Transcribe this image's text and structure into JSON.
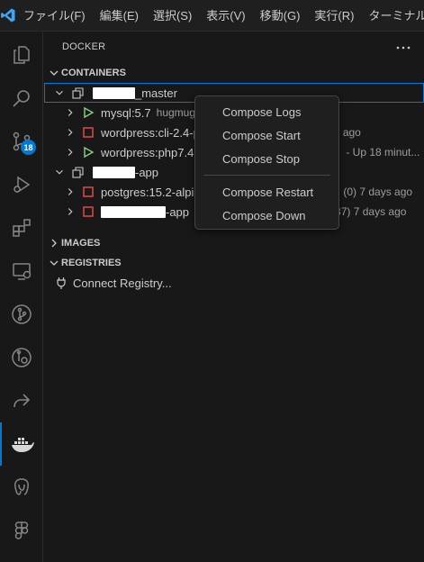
{
  "menubar": {
    "items": [
      "ファイル(F)",
      "編集(E)",
      "選択(S)",
      "表示(V)",
      "移動(G)",
      "実行(R)",
      "ターミナル(T)"
    ]
  },
  "activity": {
    "scm_badge": "18",
    "icons": [
      "explorer-icon",
      "search-icon",
      "source-control-icon",
      "run-debug-icon",
      "extensions-icon",
      "remote-explorer-icon",
      "git-graph-icon",
      "gitlens-icon",
      "share-icon",
      "docker-icon",
      "postgres-icon",
      "figma-icon"
    ]
  },
  "docker": {
    "title": "DOCKER",
    "sections": {
      "containers": "CONTAINERS",
      "images": "IMAGES",
      "registries": "REGISTRIES"
    },
    "groups": [
      {
        "name_suffix": "_master",
        "containers": [
          {
            "label": "mysql:5.7",
            "desc": "hugmug",
            "status": "running"
          },
          {
            "label": "wordpress:cli-2.4-p",
            "desc": "ago",
            "status": "stopped"
          },
          {
            "label": "wordpress:php7.4",
            "desc": "- Up 18 minut...",
            "status": "running"
          }
        ]
      },
      {
        "name_suffix": "-app",
        "containers": [
          {
            "label": "postgres:15.2-alpi",
            "desc": "(0) 7 days ago",
            "status": "stopped"
          },
          {
            "label": "-app",
            "desc": "37) 7 days ago",
            "status": "stopped"
          }
        ]
      }
    ],
    "registry_action": "Connect Registry..."
  },
  "context_menu": {
    "items": [
      "Compose Logs",
      "Compose Start",
      "Compose Stop",
      "Compose Restart",
      "Compose Down"
    ]
  },
  "colors": {
    "accent": "#0078d4",
    "running": "#89d185",
    "stopped": "#f14c4c"
  }
}
